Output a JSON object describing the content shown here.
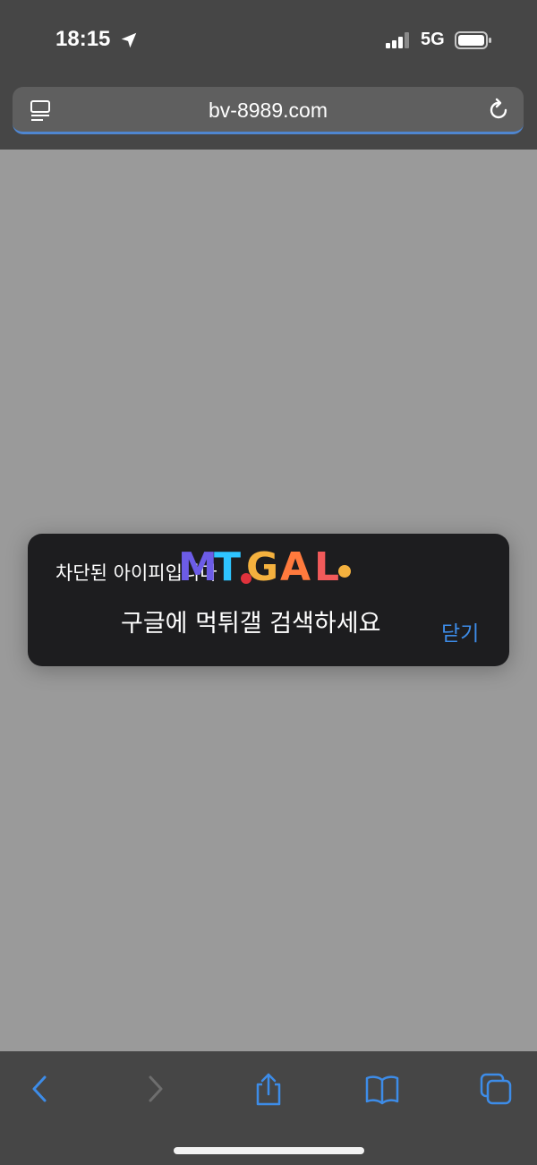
{
  "status_bar": {
    "time": "18:15",
    "network": "5G",
    "icons": [
      "location-arrow-icon",
      "signal-icon",
      "battery-icon"
    ]
  },
  "address_bar": {
    "url": "bv-8989.com",
    "icons": [
      "reader-mode-icon",
      "reload-icon"
    ]
  },
  "toast": {
    "message": "차단된 아이피입니다",
    "watermark_text": "MTGAL",
    "subtitle": "구글에 먹튀갤 검색하세요",
    "close_label": "닫기"
  },
  "toolbar": {
    "icons": [
      "back-icon",
      "forward-icon",
      "share-icon",
      "bookmarks-icon",
      "tabs-icon"
    ]
  },
  "colors": {
    "bars": "#464646",
    "page_bg": "#9a9a9a",
    "toast_bg": "#1d1d1f",
    "accent": "#3d8ce8"
  }
}
